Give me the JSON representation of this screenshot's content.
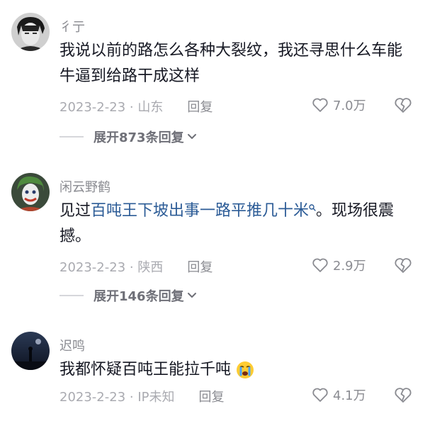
{
  "comments": [
    {
      "username": "彳亍",
      "text": "我说以前的路怎么各种大裂纹，我还寻思什么车能牛逼到给路干成这样",
      "date_location": "2023-2-23 · 山东",
      "reply_label": "回复",
      "likes": "7.0万",
      "expand_label": "展开873条回复"
    },
    {
      "username": "闲云野鹤",
      "text_prefix": "见过",
      "link_text": "百吨王下坡出事一路平推几十米",
      "text_suffix": "。现场很震撼。",
      "date_location": "2023-2-23 · 陕西",
      "reply_label": "回复",
      "likes": "2.9万",
      "expand_label": "展开146条回复"
    },
    {
      "username": "迟鸣",
      "text": "我都怀疑百吨王能拉千吨",
      "date_location": "2023-2-23 · IP未知",
      "reply_label": "回复",
      "likes": "4.1万"
    }
  ],
  "icons": {
    "like": "heart-outline-icon",
    "dislike": "broken-heart-icon",
    "expand": "chevron-down-icon",
    "search": "search-mini-icon",
    "emoji": "crying-face-emoji"
  },
  "colors": {
    "link": "#2b5b96",
    "text": "#161823",
    "meta": "#a9aab0"
  }
}
